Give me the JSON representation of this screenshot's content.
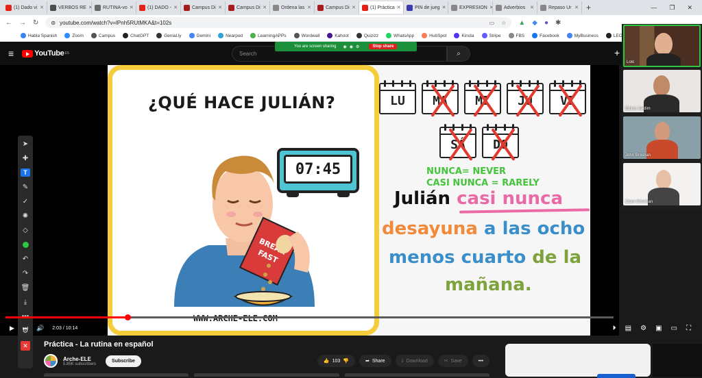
{
  "browser": {
    "tabs": [
      {
        "label": "(1) Dado vi",
        "color": "#e62117"
      },
      {
        "label": "VERBOS RE",
        "color": "#4d4d4d"
      },
      {
        "label": "RUTINA-vo",
        "color": "#6a6a6a"
      },
      {
        "label": "(1) DADO -",
        "color": "#e62117"
      },
      {
        "label": "Campus Di",
        "color": "#a61b1b"
      },
      {
        "label": "Campus Di",
        "color": "#a61b1b"
      },
      {
        "label": "Ordena las",
        "color": "#888888"
      },
      {
        "label": "Campus Di",
        "color": "#a61b1b"
      },
      {
        "label": "(1) Práctica",
        "color": "#e62117",
        "active": true
      },
      {
        "label": "PIN de jueg",
        "color": "#3b3bb0"
      },
      {
        "label": "EXPRESION",
        "color": "#888888"
      },
      {
        "label": "Adverbios",
        "color": "#888888"
      },
      {
        "label": "Repaso Ur",
        "color": "#888888"
      }
    ],
    "new_tab": "+",
    "url": "youtube.com/watch?v=lPnh5RUtMKA&t=102s",
    "bookmarks": [
      {
        "label": "Habla Spanish",
        "color": "#3b82f6"
      },
      {
        "label": "Zoom",
        "color": "#2d8cff"
      },
      {
        "label": "Campus",
        "color": "#555555"
      },
      {
        "label": "ChatGPT",
        "color": "#222222"
      },
      {
        "label": "Genial.ly",
        "color": "#333333"
      },
      {
        "label": "Gemini",
        "color": "#4285f4"
      },
      {
        "label": "Nearpod",
        "color": "#2aa6d6"
      },
      {
        "label": "LearningAPPs",
        "color": "#4caf50"
      },
      {
        "label": "Wordwall",
        "color": "#555555"
      },
      {
        "label": "Kahoot",
        "color": "#46178f"
      },
      {
        "label": "Quizizz",
        "color": "#333333"
      },
      {
        "label": "WhatsApp",
        "color": "#25d366"
      },
      {
        "label": "HubSpot",
        "color": "#ff7a59"
      },
      {
        "label": "Kinsta",
        "color": "#5333ed"
      },
      {
        "label": "Stripe",
        "color": "#635bff"
      },
      {
        "label": "FBS",
        "color": "#888888"
      },
      {
        "label": "Facebook",
        "color": "#1877f2"
      },
      {
        "label": "MyBusiness",
        "color": "#4285f4"
      },
      {
        "label": "LEO Wexford",
        "color": "#222222"
      }
    ]
  },
  "youtube": {
    "logo_text": "YouTube",
    "logo_region": "ES",
    "search_placeholder": "Search",
    "create_icon": "+",
    "screen_share": {
      "message": "You are screen sharing",
      "stop_label": "Stop share"
    }
  },
  "video": {
    "slide": {
      "title": "¿QUÉ HACE JULIÁN?",
      "clock_time": "07:45",
      "calendar_days": [
        "LU",
        "MA",
        "MI",
        "JU",
        "VI",
        "SÁ",
        "DO"
      ],
      "def1": "NUNCA= NEVER",
      "def2": "CASI NUNCA = RARELY",
      "s1_a": "Julián ",
      "s1_b": "casi nunca",
      "s2_a": "desayuna",
      "s2_b": " a las ocho",
      "s3_a": "menos cuarto ",
      "s3_b": "de la",
      "s4": "mañana.",
      "box_text": "BREAKFAST",
      "site": "WWW.ARCHE-ELE.COM"
    },
    "time_current": "2:03",
    "time_total": "10:14",
    "time_display": "2:03 / 10:14",
    "progress_fraction": 0.2003,
    "title": "Práctica - La rutina en español",
    "channel": "Arche-ELE",
    "subscribers": "5.85K subscribers",
    "subscribe_label": "Subscribe",
    "likes": "103",
    "share_label": "Share",
    "download_label": "Download",
    "save_label": "Save"
  },
  "participants": [
    {
      "name": "Lolo"
    },
    {
      "name": "Edson Jardim"
    },
    {
      "name": "John Brosnan"
    },
    {
      "name": "Clare Sheehan"
    }
  ]
}
